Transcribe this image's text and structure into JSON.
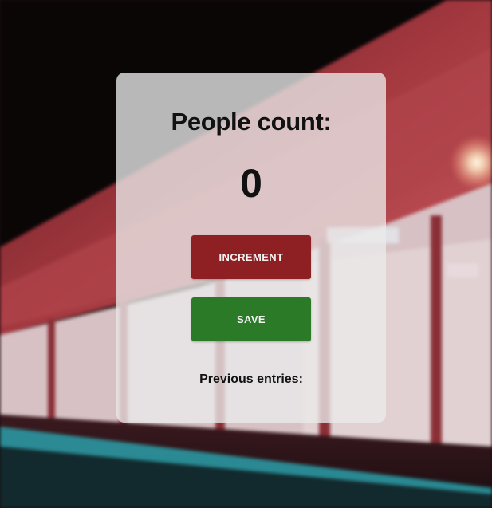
{
  "counter": {
    "title": "People count:",
    "value": "0",
    "increment_label": "INCREMENT",
    "save_label": "SAVE",
    "previous_entries_label": "Previous entries:"
  },
  "background": {
    "description": "blurred train station platform at night",
    "colors": {
      "sky": "#0a0606",
      "roof": "#a3383f",
      "platform_wall": "#d7c1c4",
      "rail_light": "#2aa7b3"
    }
  },
  "colors": {
    "increment_button": "#8e1f22",
    "save_button": "#2a7a27",
    "card": "rgba(235,235,235,0.78)"
  }
}
